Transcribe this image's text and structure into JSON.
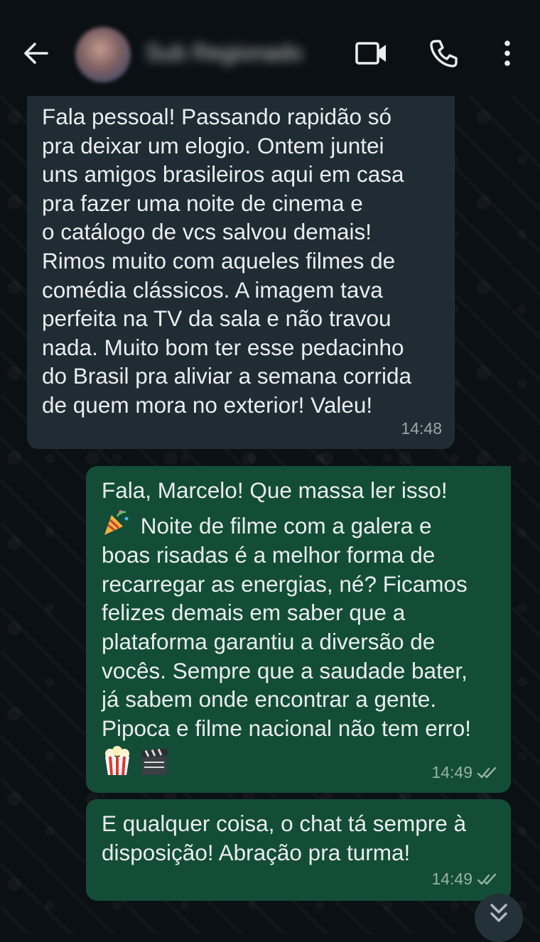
{
  "header": {
    "contact_name": "Sub Regionado",
    "icons": [
      "back-arrow-icon",
      "video-call-icon",
      "voice-call-icon",
      "more-options-icon"
    ]
  },
  "messages": [
    {
      "direction": "incoming",
      "text": "Fala pessoal! Passando rapidão só\npra deixar um elogio. Ontem juntei\nuns amigos brasileiros aqui em casa\npra fazer uma noite de cinema e\no catálogo de vcs salvou demais!\nRimos muito com aqueles filmes de\ncomédia clássicos. A imagem tava\nperfeita na TV da sala e não travou\nnada. Muito bom ter esse pedacinho\ndo Brasil pra aliviar a semana corrida\nde quem mora no exterior! Valeu!",
      "time": "14:48"
    },
    {
      "direction": "outgoing",
      "line1": "Fala, Marcelo! Que massa ler isso!",
      "line2": "Noite de filme com a galera e",
      "text": "boas risadas é a melhor forma de\nrecarregar as energias, né? Ficamos\nfelizes demais em saber que a\nplataforma garantiu a diversão de\nvocês. Sempre que a saudade bater,\njá sabem onde encontrar a gente.\nPipoca e filme nacional não tem erro!",
      "emojis": [
        "party-popper-icon",
        "popcorn-icon",
        "clapper-board-icon"
      ],
      "time": "14:49",
      "status": "read"
    },
    {
      "direction": "outgoing",
      "text": "E qualquer coisa, o chat tá sempre à\ndisposição! Abração pra turma!",
      "time": "14:49",
      "status": "read"
    }
  ],
  "colors": {
    "background": "#0b1014",
    "incoming_bubble": "#202c33",
    "outgoing_bubble": "#134d37",
    "text": "#e9edef",
    "meta": "#8696a0"
  }
}
